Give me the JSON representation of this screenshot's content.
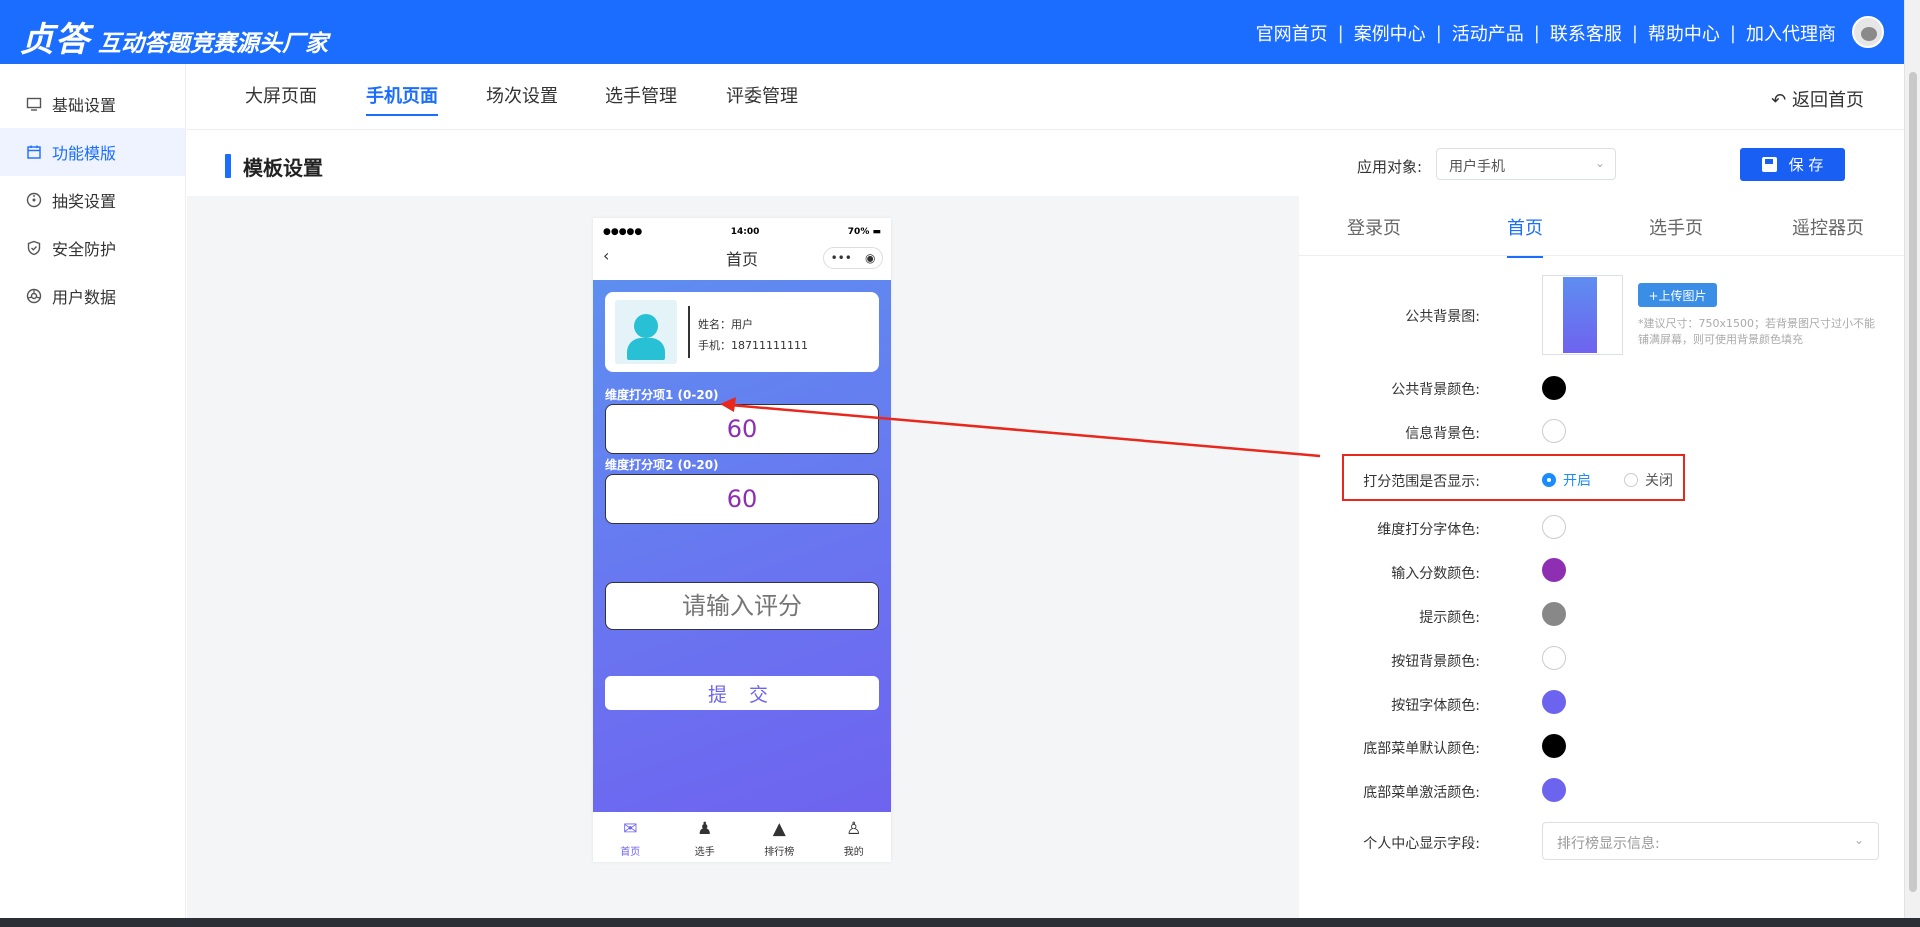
{
  "header": {
    "brand_logo": "贞答",
    "brand_slogan": "互动答题竞赛源头厂家",
    "nav": [
      "官网首页",
      "案例中心",
      "活动产品",
      "联系客服",
      "帮助中心",
      "加入代理商"
    ],
    "separator": "|"
  },
  "sidebar": {
    "items": [
      {
        "label": "基础设置",
        "icon": "monitor-icon"
      },
      {
        "label": "功能模版",
        "icon": "calendar-icon",
        "active": true
      },
      {
        "label": "抽奖设置",
        "icon": "dial-icon"
      },
      {
        "label": "安全防护",
        "icon": "shield-icon"
      },
      {
        "label": "用户数据",
        "icon": "aperture-icon"
      }
    ]
  },
  "tabs": {
    "items": [
      "大屏页面",
      "手机页面",
      "场次设置",
      "选手管理",
      "评委管理"
    ],
    "active": "手机页面",
    "back_home": "返回首页",
    "back_icon": "↶"
  },
  "template": {
    "title": "模板设置",
    "apply_label": "应用对象:",
    "apply_value": "用户手机",
    "select_chevron": "⌄",
    "save_label": "保 存"
  },
  "phone": {
    "status_signal": "●●●●●",
    "status_time": "14:00",
    "status_battery": "70% ▬",
    "back_glyph": "‹",
    "nav_title": "首页",
    "capsule_menu": "•••",
    "capsule_close": "◉",
    "profile_name": "姓名：用户",
    "profile_phone": "手机：18711111111",
    "dim1_label": "维度打分项1 (0-20)",
    "dim1_value": "60",
    "dim2_label": "维度打分项2 (0-20)",
    "dim2_value": "60",
    "input_placeholder": "请输入评分",
    "submit_label": "提 交",
    "tabbar": [
      {
        "label": "首页",
        "glyph": "✉"
      },
      {
        "label": "选手",
        "glyph": "♟"
      },
      {
        "label": "排行榜",
        "glyph": "▲"
      },
      {
        "label": "我的",
        "glyph": "♙"
      }
    ]
  },
  "settings": {
    "page_tabs": [
      "登录页",
      "首页",
      "选手页",
      "遥控器页"
    ],
    "active_page_tab": "首页",
    "bg_image_label": "公共背景图:",
    "upload_label": "+上传图片",
    "upload_hint": "*建议尺寸：750x1500；若背景图尺寸过小不能铺满屏幕，则可使用背景颜色填充",
    "bg_color_label": "公共背景颜色:",
    "info_bg_label": "信息背景色:",
    "range_label": "打分范围是否显示:",
    "radio_on": "开启",
    "radio_off": "关闭",
    "dim_font_label": "维度打分字体色:",
    "input_score_label": "输入分数颜色:",
    "hint_color_label": "提示颜色:",
    "btn_bg_label": "按钮背景颜色:",
    "btn_font_label": "按钮字体颜色:",
    "menu_default_label": "底部菜单默认颜色:",
    "menu_active_label": "底部菜单激活颜色:",
    "profile_field_label": "个人中心显示字段:",
    "profile_field_placeholder": "排行榜显示信息:",
    "colors": {
      "bg_color": "#000000",
      "info_bg": "#ffffff",
      "dim_font": "#ffffff",
      "input_score": "#8e2eb3",
      "hint": "#888888",
      "btn_bg": "#ffffff",
      "btn_font": "#6c63ef",
      "menu_default": "#000000",
      "menu_active": "#6c63ef"
    }
  }
}
